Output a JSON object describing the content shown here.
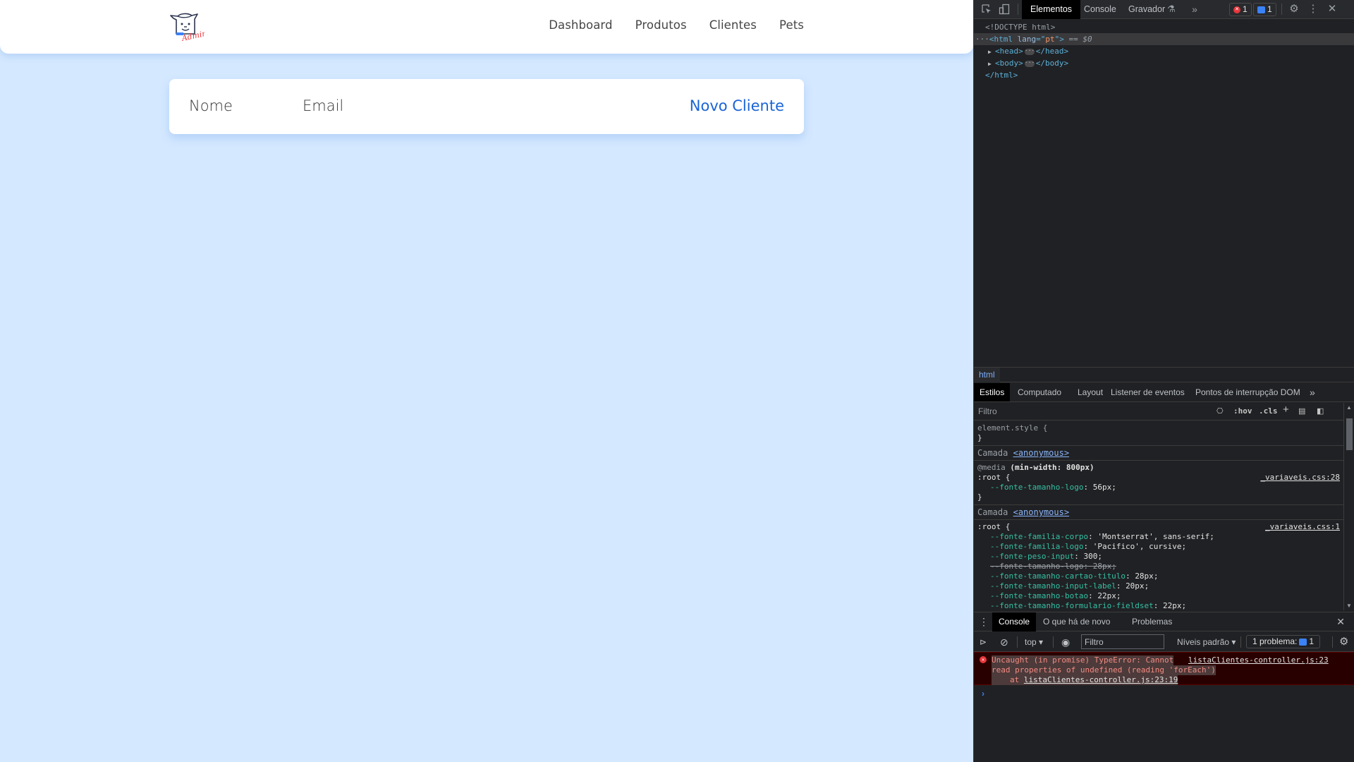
{
  "page": {
    "logo": {
      "icon": "dog-mascot-logo",
      "text": "Admin",
      "text_color": "#e8363b"
    },
    "nav": [
      {
        "label": "Dashboard"
      },
      {
        "label": "Produtos"
      },
      {
        "label": "Clientes"
      },
      {
        "label": "Pets"
      }
    ],
    "table": {
      "columns": [
        "Nome",
        "Email"
      ],
      "rows": [],
      "new_client_label": "Novo Cliente",
      "link_color": "#1a64d6"
    },
    "background_color": "#d4e8ff"
  },
  "devtools": {
    "toolbar": {
      "tabs": [
        {
          "label": "Elementos",
          "active": true
        },
        {
          "label": "Console",
          "active": false
        },
        {
          "label": "Gravador",
          "active": false
        }
      ],
      "error_count": "1",
      "message_count": "1"
    },
    "dom": {
      "doctype": "<!DOCTYPE html>",
      "html_open_tag": "html",
      "html_attr_name": "lang",
      "html_attr_value": "pt",
      "selected_marker": "== $0",
      "head_tag": "head",
      "body_tag": "body",
      "html_close": "</html>"
    },
    "breadcrumb": "html",
    "styles_tabs": [
      {
        "label": "Estilos",
        "active": true
      },
      {
        "label": "Computado",
        "active": false
      },
      {
        "label": "Layout",
        "active": false
      },
      {
        "label": "Listener de eventos",
        "active": false
      },
      {
        "label": "Pontos de interrupção DOM",
        "active": false
      }
    ],
    "styles_filter_placeholder": "Filtro",
    "styles_filter_buttons": [
      ":hov",
      ".cls"
    ],
    "styles": {
      "element_style": "element.style {",
      "layer_label": "Camada",
      "layer_link": "<anonymous>",
      "media_rule": {
        "media_keyword": "@media",
        "media_query": "(min-width: 800px)",
        "selector": ":root {",
        "source": "_variaveis.css:28",
        "properties": [
          {
            "name": "--fonte-tamanho-logo",
            "value": "56px",
            "struck": false
          }
        ]
      },
      "root_rule": {
        "selector": ":root {",
        "source": "_variaveis.css:1",
        "properties": [
          {
            "name": "--fonte-familia-corpo",
            "value": "'Montserrat', sans-serif",
            "struck": false
          },
          {
            "name": "--fonte-familia-logo",
            "value": "'Pacifico', cursive",
            "struck": false
          },
          {
            "name": "--fonte-peso-input",
            "value": "300",
            "struck": false
          },
          {
            "name": "--fonte-tamanho-logo",
            "value": "28px",
            "struck": true
          },
          {
            "name": "--fonte-tamanho-cartao-titulo",
            "value": "28px",
            "struck": false
          },
          {
            "name": "--fonte-tamanho-input-label",
            "value": "20px",
            "struck": false
          },
          {
            "name": "--fonte-tamanho-botao",
            "value": "22px",
            "struck": false
          },
          {
            "name": "--fonte-tamanho-formulario-fieldset",
            "value": "22px",
            "struck": false
          }
        ]
      }
    },
    "drawer": {
      "tabs": [
        {
          "label": "Console",
          "active": true
        },
        {
          "label": "O que há de novo",
          "active": false
        },
        {
          "label": "Problemas",
          "active": false
        }
      ],
      "context": "top",
      "filter_placeholder": "Filtro",
      "levels": "Níveis padrão",
      "issues_label": "1 problema:",
      "issues_count": "1"
    },
    "console_error": {
      "line1": "Uncaught (in promise) TypeError: Cannot",
      "line2": "read properties of undefined (reading 'forEach')",
      "at_prefix": "at",
      "stack_link": "listaClientes-controller.js:23:19",
      "source_link": "listaClientes-controller.js:23"
    },
    "prompt": "›"
  }
}
